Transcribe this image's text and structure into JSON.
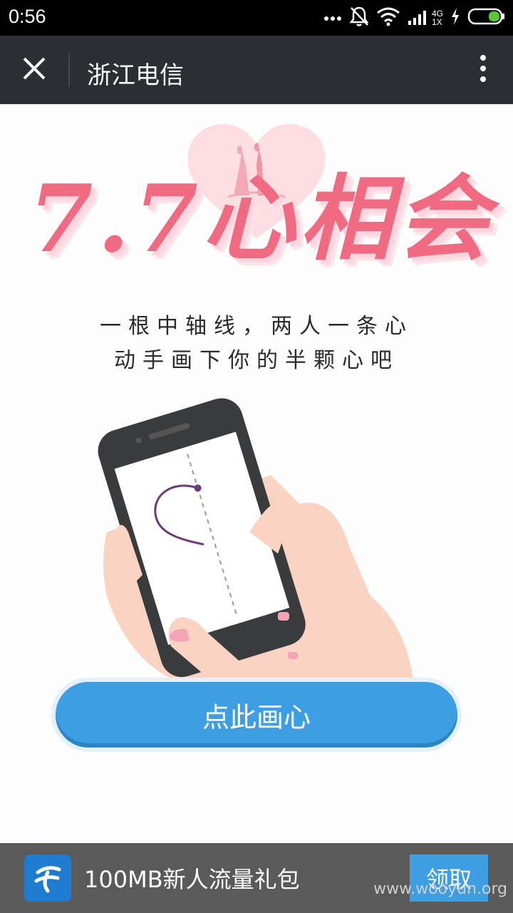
{
  "status": {
    "time": "0:56",
    "network": "4G",
    "network_sub": "1X"
  },
  "header": {
    "title": "浙江电信"
  },
  "banner": {
    "headline": "7.7心相会"
  },
  "subtitle": {
    "line1": "一根中轴线，两人一条心",
    "line2": "动手画下你的半颗心吧"
  },
  "cta": {
    "label": "点此画心"
  },
  "promo": {
    "text": "100MB新人流量礼包",
    "button": "领取",
    "watermark": "www.wooyun.org"
  },
  "colors": {
    "accent": "#3d9ee3",
    "headline": "#f06b82",
    "header_bg": "#2b2f33"
  },
  "icons": [
    "close-icon",
    "more-vertical-icon",
    "dots-icon",
    "bell-muted-icon",
    "wifi-icon",
    "signal-icon",
    "charging-icon",
    "battery-icon",
    "telecom-logo-icon"
  ]
}
